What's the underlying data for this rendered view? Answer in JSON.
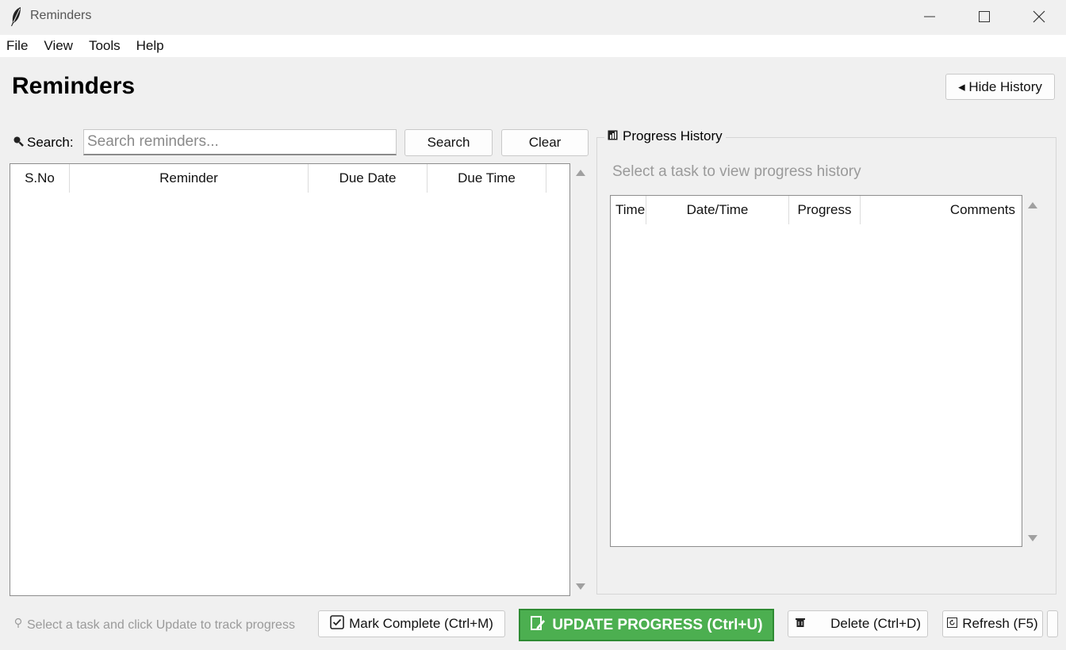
{
  "window": {
    "title": "Reminders",
    "icon": "feather-icon"
  },
  "menu": [
    "File",
    "View",
    "Tools",
    "Help"
  ],
  "header": {
    "title": "Reminders",
    "hide_history_label": "◂ Hide History"
  },
  "search": {
    "label": "Search:",
    "placeholder": "Search reminders...",
    "value": "",
    "search_button": "Search",
    "clear_button": "Clear",
    "icon": "magnifier-icon"
  },
  "reminders_table": {
    "columns": [
      "S.No",
      "Reminder",
      "Due Date",
      "Due Time",
      ""
    ],
    "rows": []
  },
  "progress_history": {
    "title": "Progress History",
    "icon": "chart-icon",
    "hint": "Select a task to view progress history",
    "columns": [
      "Time",
      "Date/Time",
      "Progress",
      "Comments"
    ],
    "rows": []
  },
  "footer": {
    "hint": "Select a task and click Update to track progress",
    "mark_complete": "Mark Complete (Ctrl+M)",
    "update_progress": "UPDATE PROGRESS (Ctrl+U)",
    "delete": "Delete (Ctrl+D)",
    "refresh": "Refresh (F5)"
  },
  "colors": {
    "accent_green": "#4caf50",
    "background": "#f0f0f0"
  }
}
